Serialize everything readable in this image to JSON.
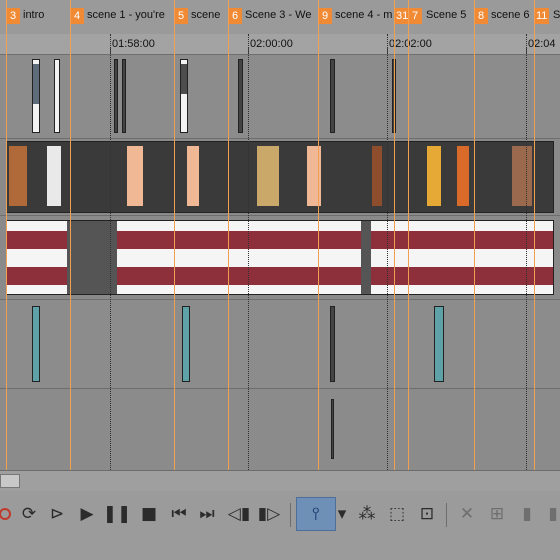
{
  "markers": [
    {
      "num": "3",
      "label": "intro"
    },
    {
      "num": "4",
      "label": "scene 1 - you're"
    },
    {
      "num": "5",
      "label": "scene"
    },
    {
      "num": "6",
      "label": "Scene 3 - We"
    },
    {
      "num": "9",
      "label": "scene 4 - m"
    },
    {
      "num": "31",
      "label": ""
    },
    {
      "num": "7",
      "label": "Scene 5"
    },
    {
      "num": "8",
      "label": "scene 6"
    },
    {
      "num": "11",
      "label": "S"
    }
  ],
  "ruler": {
    "labels": [
      "01:58:00",
      "02:00:00",
      "02:02:00",
      "02:04"
    ]
  },
  "colors": {
    "marker": "#f08a34",
    "audio_wave": "#8e2f3c",
    "active_tool": "#6e8fb6"
  },
  "toolbar": {
    "record_icon": "record-icon",
    "loop_icon": "loop-icon",
    "play_from_start_icon": "play-from-start-icon",
    "play_icon": "play-icon",
    "pause_icon": "pause-icon",
    "stop_icon": "stop-icon",
    "prev_icon": "go-to-start-icon",
    "next_icon": "go-to-end-icon",
    "prev_frame_icon": "previous-frame-icon",
    "next_frame_icon": "next-frame-icon",
    "edit_tool_icon": "normal-edit-tool-icon",
    "envelope_icon": "envelope-tool-icon",
    "selection_icon": "selection-tool-icon",
    "zoom_icon": "zoom-tool-icon",
    "delete_icon": "delete-icon",
    "trim_icon": "trim-icon"
  }
}
